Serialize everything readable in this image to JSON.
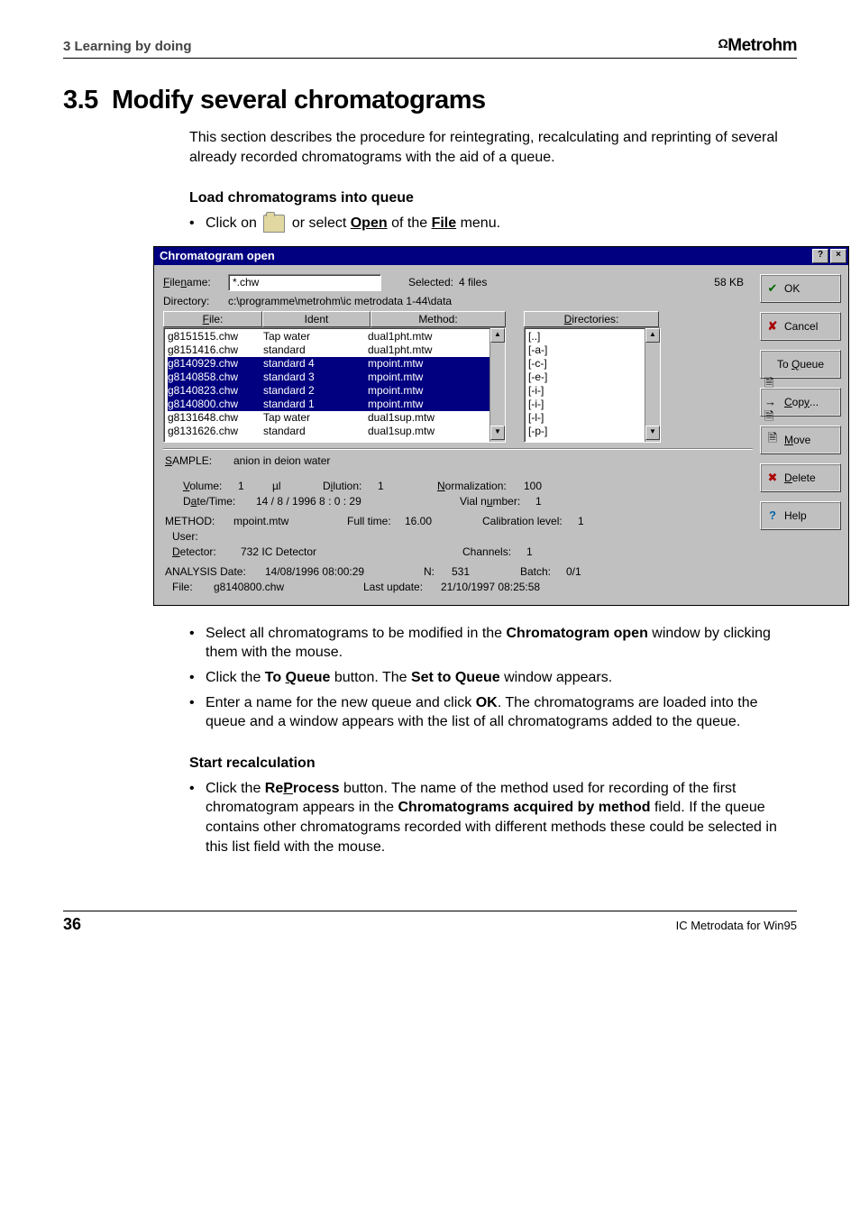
{
  "header": {
    "chapter": "3  Learning by doing",
    "brand": "Metrohm"
  },
  "section": {
    "number": "3.5",
    "title": "Modify several chromatograms",
    "intro": "This section describes the procedure for reintegrating, recalculating and reprinting of several already recorded chromatograms with the aid of a queue.",
    "sub1": "Load chromatograms into queue",
    "b1a": "Click on ",
    "b1b": " or select ",
    "b1_open": "Open",
    "b1_of": " of the ",
    "b1_file": "File",
    "b1_end": " menu.",
    "b2a": "Select all chromatograms to be modified in the ",
    "b2_bold": "Chromatogram open",
    "b2b": " window by clicking them with the mouse.",
    "b3a": "Click the ",
    "b3_bold": "To Queue",
    "b3b": " button. The ",
    "b3_bold2": "Set to Queue",
    "b3c": " window appears.",
    "b4a": "Enter a name for the new queue and click ",
    "b4_bold": "OK",
    "b4b": ". The chromatograms are loaded into the queue and a window appears with the list of all chromatograms added to the queue.",
    "sub2": "Start recalculation",
    "b5a": "Click the ",
    "b5_bold": "ReProcess",
    "b5b": " button. The name of the method used for recording of the first chromatogram appears in the ",
    "b5_bold2": "Chromatograms acquired by method",
    "b5c": " field. If the queue contains other chromatograms recorded with different methods these could be selected in this list field with the mouse."
  },
  "dialog": {
    "title": "Chromatogram open",
    "filename_lbl": "Filename:",
    "filename_val": "*.chw",
    "selected_lbl": "Selected:",
    "selected_val": "4 files",
    "size": "58 KB",
    "directory_lbl": "Directory:",
    "directory_val": "c:\\programme\\metrohm\\ic metrodata 1-44\\data",
    "col_file": "File:",
    "col_ident": "Ident",
    "col_method": "Method:",
    "col_dirs": "Directories:",
    "files": [
      "g8151515.chw",
      "g8151416.chw",
      "g8140929.chw",
      "g8140858.chw",
      "g8140823.chw",
      "g8140800.chw",
      "g8131648.chw",
      "g8131626.chw"
    ],
    "idents": [
      "Tap water",
      "standard",
      "standard 4",
      "standard 3",
      "standard 2",
      "standard 1",
      "Tap water",
      "standard"
    ],
    "methods": [
      "dual1pht.mtw",
      "dual1pht.mtw",
      "mpoint.mtw",
      "mpoint.mtw",
      "mpoint.mtw",
      "mpoint.mtw",
      "dual1sup.mtw",
      "dual1sup.mtw"
    ],
    "dirs": [
      "[..]",
      "[-a-]",
      "[-c-]",
      "[-e-]",
      "[-i-]",
      "[-i-]",
      "[-l-]",
      "[-p-]"
    ],
    "sample_lbl": "SAMPLE:",
    "sample_val": "anion in deion water",
    "volume_lbl": "Volume:",
    "volume_val": "1",
    "volume_unit": "µl",
    "dilution_lbl": "Dilution:",
    "dilution_val": "1",
    "norm_lbl": "Normalization:",
    "norm_val": "100",
    "datetime_lbl": "Date/Time:",
    "datetime_val": "14   / 8    / 1996        8     : 0     : 29",
    "vial_lbl": "Vial number:",
    "vial_val": "1",
    "method_lbl": "METHOD:",
    "method_val": "mpoint.mtw",
    "fulltime_lbl": "Full time:",
    "fulltime_val": "16.00",
    "calib_lbl": "Calibration level:",
    "calib_val": "1",
    "user_lbl": "User:",
    "detector_lbl": "Detector:",
    "detector_val": "732 IC Detector",
    "channels_lbl": "Channels:",
    "channels_val": "1",
    "analysis_lbl": "ANALYSIS  Date:",
    "analysis_val": "14/08/1996 08:00:29",
    "n_lbl": "N:",
    "n_val": "531",
    "batch_lbl": "Batch:",
    "batch_val": "0/1",
    "file_lbl": "File:",
    "file_val": "g8140800.chw",
    "last_lbl": "Last update:",
    "last_val": "21/10/1997 08:25:58",
    "btn_ok": "OK",
    "btn_cancel": "Cancel",
    "btn_queue": "To Queue",
    "btn_copy": "Copy...",
    "btn_move": "Move",
    "btn_delete": "Delete",
    "btn_help": "Help"
  },
  "footer": {
    "page": "36",
    "right": "IC Metrodata for Win95"
  }
}
